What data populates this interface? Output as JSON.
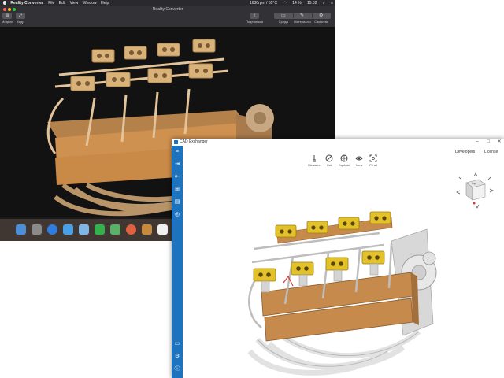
{
  "mac": {
    "menubar": {
      "app_name": "Reality Converter",
      "menus": [
        "File",
        "Edit",
        "View",
        "Window",
        "Help"
      ],
      "clock_status": "1630rpm / 55°C",
      "battery": "14 %",
      "time": "15:32"
    },
    "window_title": "Reality Converter",
    "toolbar": {
      "left_buttons": [
        "Модели",
        "Кадр"
      ],
      "share_label": "Поделиться",
      "segments": [
        "Среды",
        "Материалы",
        "Свойства"
      ]
    }
  },
  "cad": {
    "window_title": "CAD Exchanger",
    "nav": {
      "developers": "Developers",
      "license": "License"
    },
    "tools": [
      "Measure",
      "Cut",
      "Explode",
      "View",
      "Fit all"
    ],
    "viewcube_label": "top",
    "colors": {
      "accent": "#1e73be",
      "part": "#c68a4c",
      "intake": "#e3c12a"
    }
  }
}
